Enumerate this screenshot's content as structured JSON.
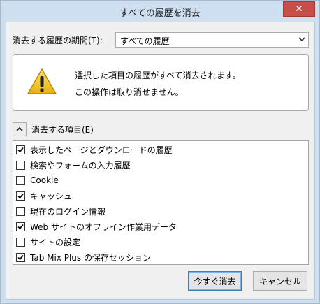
{
  "window": {
    "title": "すべての履歴を消去",
    "close_glyph": "✕"
  },
  "period": {
    "label": "消去する履歴の期間(T):",
    "selected": "すべての履歴"
  },
  "warning": {
    "line1": "選択した項目の履歴がすべて消去されます。",
    "line2": "この操作は取り消せません。"
  },
  "items_section": {
    "label": "消去する項目(E)",
    "items": [
      {
        "label": "表示したページとダウンロードの履歴",
        "checked": true
      },
      {
        "label": "検索やフォームの入力履歴",
        "checked": false
      },
      {
        "label": "Cookie",
        "checked": false
      },
      {
        "label": "キャッシュ",
        "checked": true
      },
      {
        "label": "現在のログイン情報",
        "checked": false
      },
      {
        "label": "Web サイトのオフライン作業用データ",
        "checked": true
      },
      {
        "label": "サイトの設定",
        "checked": false
      },
      {
        "label": "Tab Mix Plus の保存セッション",
        "checked": true
      }
    ]
  },
  "buttons": {
    "clear_now": "今すぐ消去",
    "cancel": "キャンセル"
  },
  "icons": {
    "warning": "warning-icon",
    "collapse": "chevron-up-icon",
    "dropdown": "chevron-down-icon",
    "checkmark": "checkmark-icon",
    "close": "close-icon"
  },
  "colors": {
    "title_bar": "#cddff0",
    "close_button": "#c74e47",
    "warning_yellow": "#f5c518"
  }
}
